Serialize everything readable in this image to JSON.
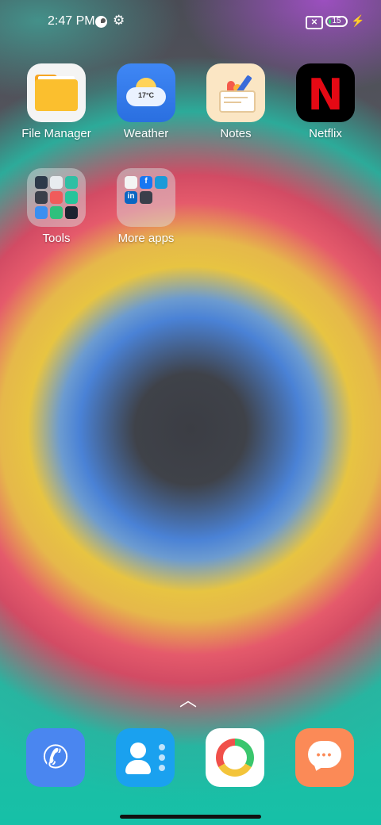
{
  "status_bar": {
    "time": "2:47 PM",
    "battery_level": "15",
    "battery_fraction": 0.15,
    "icons": [
      "data-saver-icon",
      "settings-gear-icon",
      "sim-off-icon",
      "battery-icon",
      "charging-bolt-icon"
    ]
  },
  "apps": [
    {
      "label": "File Manager",
      "icon": "folder-icon"
    },
    {
      "label": "Weather",
      "icon": "weather-cloud-sun-icon",
      "temp": "17°C"
    },
    {
      "label": "Notes",
      "icon": "notes-pen-cup-icon"
    },
    {
      "label": "Netflix",
      "icon": "netflix-n-icon",
      "glyph": "N"
    }
  ],
  "folders": [
    {
      "label": "Tools"
    },
    {
      "label": "More apps"
    }
  ],
  "dock": [
    {
      "name": "phone",
      "icon": "phone-icon"
    },
    {
      "name": "contacts",
      "icon": "contacts-icon"
    },
    {
      "name": "camera",
      "icon": "camera-ring-icon"
    },
    {
      "name": "messages",
      "icon": "message-bubble-icon"
    }
  ],
  "colors": {
    "netflix_red": "#e50914",
    "weather_blue": "#3f87f5",
    "contacts_blue": "#1aa1ef",
    "messages_orange": "#fb8a57",
    "battery_green": "#3ac66d"
  }
}
